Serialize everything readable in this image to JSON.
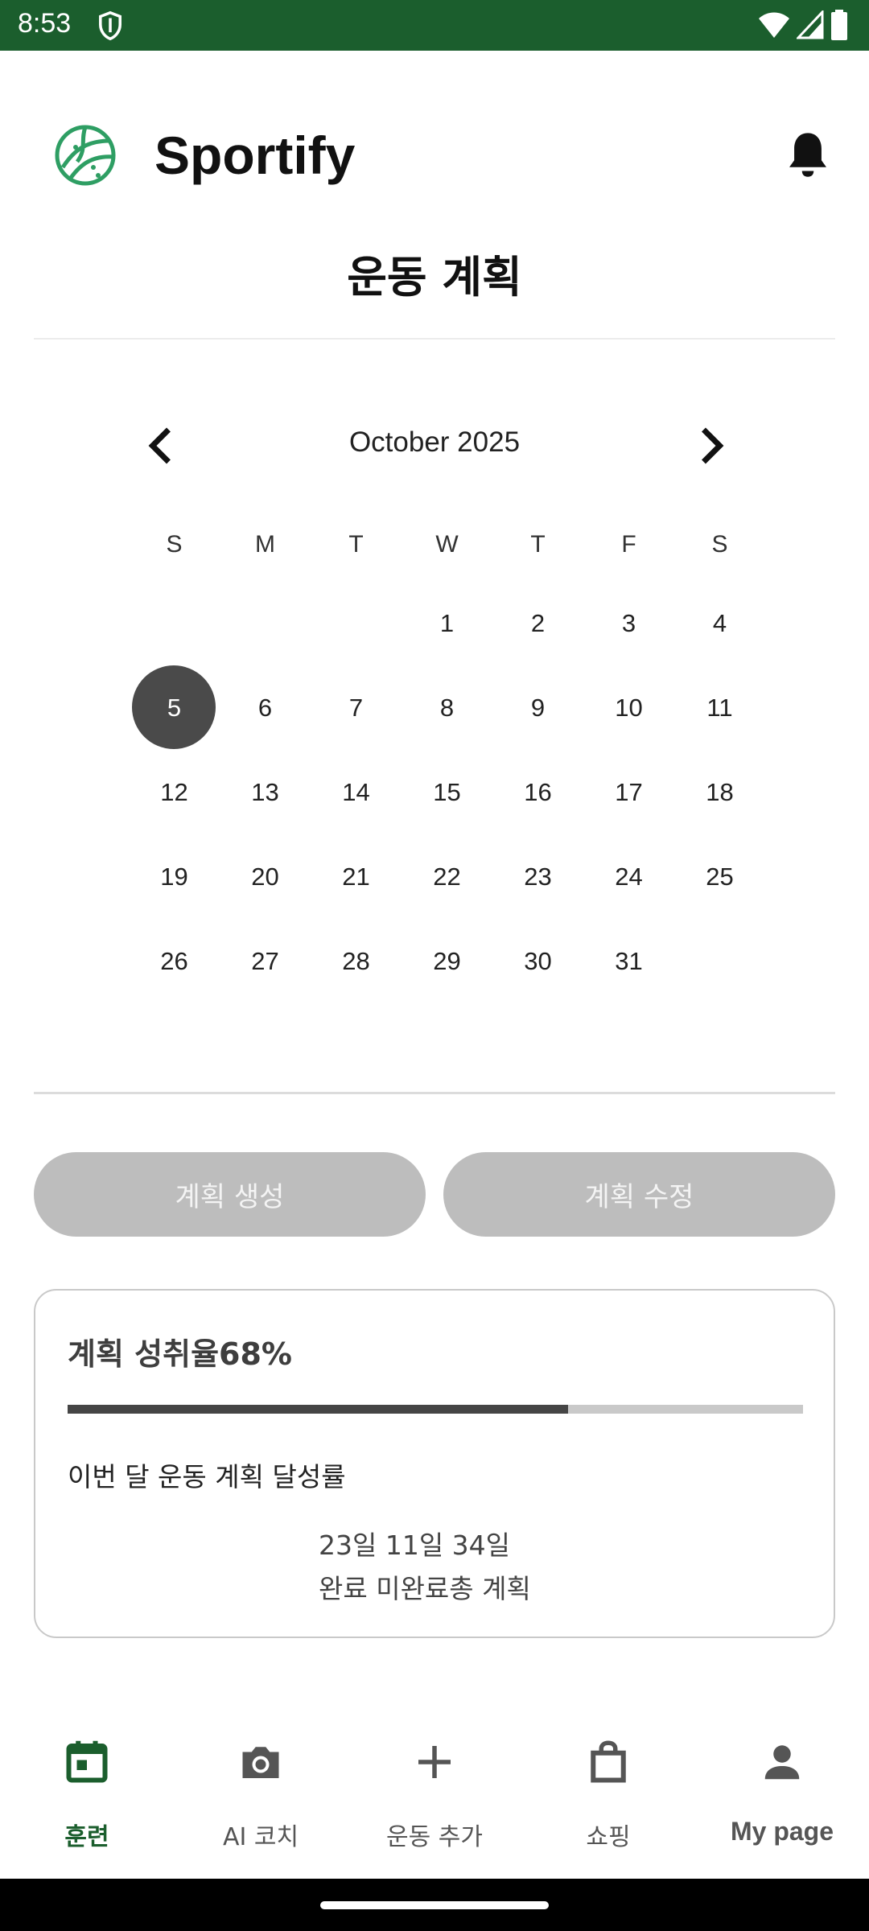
{
  "status_bar": {
    "time": "8:53"
  },
  "header": {
    "app_title": "Sportify",
    "page_title": "운동 계획"
  },
  "calendar": {
    "month_label": "October 2025",
    "weekdays": [
      "S",
      "M",
      "T",
      "W",
      "T",
      "F",
      "S"
    ],
    "leading_blanks": 3,
    "days": [
      "1",
      "2",
      "3",
      "4",
      "5",
      "6",
      "7",
      "8",
      "9",
      "10",
      "11",
      "12",
      "13",
      "14",
      "15",
      "16",
      "17",
      "18",
      "19",
      "20",
      "21",
      "22",
      "23",
      "24",
      "25",
      "26",
      "27",
      "28",
      "29",
      "30",
      "31"
    ],
    "selected_day": "5"
  },
  "actions": {
    "create_label": "계획 생성",
    "edit_label": "계획 수정"
  },
  "achievement": {
    "title": "계획 성취율68%",
    "progress_fraction": 0.68,
    "subtitle": "이번 달 운동 계획 달성률",
    "stats_line1": "23일 11일 34일",
    "stats_line2": "완료 미완료총 계획"
  },
  "bottom_nav": [
    {
      "label": "훈련",
      "icon": "calendar-icon",
      "active": true
    },
    {
      "label": "AI 코치",
      "icon": "camera-icon",
      "active": false
    },
    {
      "label": "운동 추가",
      "icon": "plus-icon",
      "active": false
    },
    {
      "label": "쇼핑",
      "icon": "shopping-bag-icon",
      "active": false
    },
    {
      "label": "My page",
      "icon": "person-icon",
      "active": false
    }
  ],
  "colors": {
    "brand_green": "#1b5e2d",
    "logo_green": "#2e9e63",
    "button_gray": "#bdbdbd",
    "selected_day": "#4a4a4a"
  }
}
